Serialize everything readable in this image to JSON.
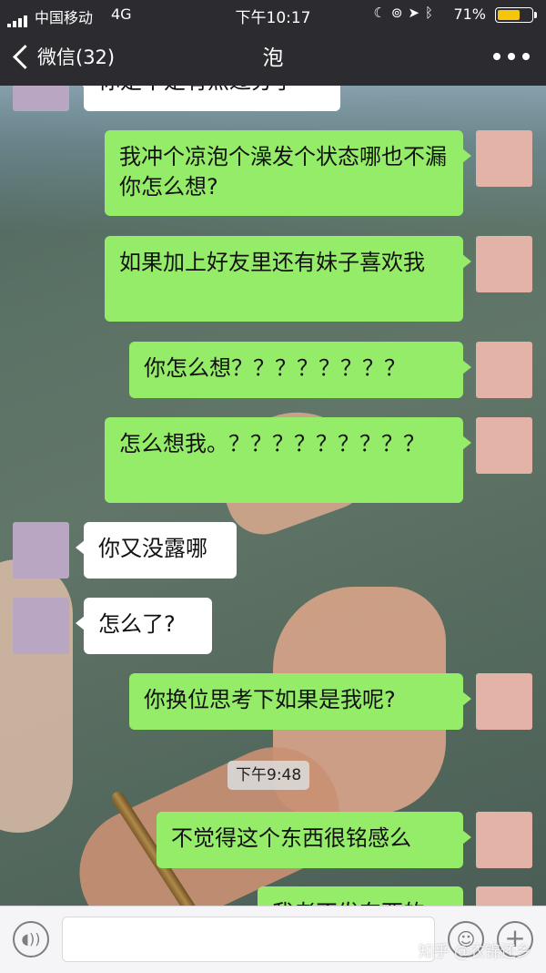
{
  "status_bar": {
    "carrier": "中国移动",
    "network": "4G",
    "time": "下午10:17",
    "battery_percent": "71%",
    "battery_level": 0.71,
    "icons": [
      "moon-icon",
      "rotation-lock-icon",
      "location-icon",
      "bluetooth-icon"
    ]
  },
  "nav": {
    "back_label": "微信(32)",
    "title": "泡"
  },
  "messages": [
    {
      "from": "her",
      "text": "你是不是有点过分了"
    },
    {
      "from": "me",
      "text": "我冲个凉泡个澡发个状态哪也不漏你怎么想?"
    },
    {
      "from": "me",
      "text": "如果加上好友里还有妹子喜欢我"
    },
    {
      "from": "me",
      "text": "你怎么想？？？？？？？？"
    },
    {
      "from": "me",
      "text": "怎么想我。？？？？？？？？？"
    },
    {
      "from": "her",
      "text": "你又没露哪"
    },
    {
      "from": "her",
      "text": "怎么了?"
    },
    {
      "from": "me",
      "text": "你换位思考下如果是我呢?"
    },
    {
      "from": "me",
      "text": "不觉得这个东西很铭感么"
    },
    {
      "from": "me",
      "text": "我老不发东西的"
    }
  ],
  "timestamp": "下午9:48",
  "input_bar": {
    "voice_icon": "voice-icon",
    "emoji_icon": "emoji-icon",
    "plus_icon": "plus-icon"
  },
  "watermark": "知乎 @衣锦还乡",
  "colors": {
    "my_bubble": "#95ec69",
    "her_bubble": "#ffffff",
    "topbar": "#2b2b30",
    "battery": "#f5c50c"
  }
}
